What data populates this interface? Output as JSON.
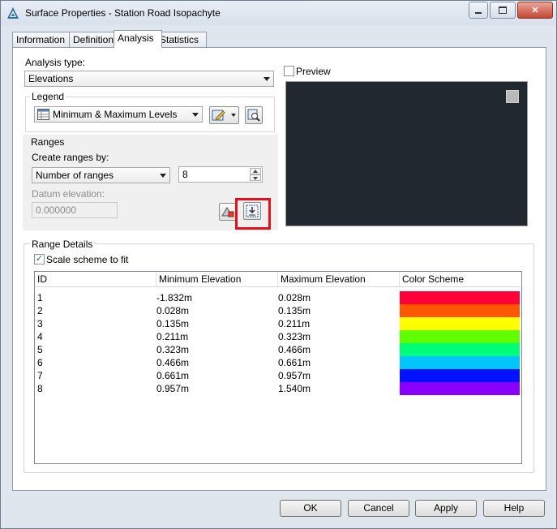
{
  "window": {
    "title": "Surface Properties - Station Road Isopachyte"
  },
  "tabs": [
    {
      "label": "Information"
    },
    {
      "label": "Definition"
    },
    {
      "label": "Analysis"
    },
    {
      "label": "Statistics"
    }
  ],
  "analysis": {
    "type_label": "Analysis type:",
    "type_value": "Elevations",
    "legend_label": "Legend",
    "legend_value": "Minimum & Maximum Levels",
    "ranges_label": "Ranges",
    "create_ranges_label": "Create ranges by:",
    "create_ranges_value": "Number of ranges",
    "number_of_ranges": "8",
    "datum_label": "Datum elevation:",
    "datum_value": "0.000000"
  },
  "preview": {
    "label": "Preview",
    "checked": false
  },
  "range_details": {
    "label": "Range Details",
    "scale_label": "Scale scheme to fit",
    "scale_checked": true,
    "headers": [
      "ID",
      "Minimum Elevation",
      "Maximum Elevation",
      "Color Scheme"
    ],
    "rows": [
      {
        "id": "1",
        "min": "-1.832m",
        "max": "0.028m",
        "color": "#ff0038"
      },
      {
        "id": "2",
        "min": "0.028m",
        "max": "0.135m",
        "color": "#ff5600"
      },
      {
        "id": "3",
        "min": "0.135m",
        "max": "0.211m",
        "color": "#ffff00"
      },
      {
        "id": "4",
        "min": "0.211m",
        "max": "0.323m",
        "color": "#60ff00"
      },
      {
        "id": "5",
        "min": "0.323m",
        "max": "0.466m",
        "color": "#00ff78"
      },
      {
        "id": "6",
        "min": "0.466m",
        "max": "0.661m",
        "color": "#00c6ff"
      },
      {
        "id": "7",
        "min": "0.661m",
        "max": "0.957m",
        "color": "#0012ff"
      },
      {
        "id": "8",
        "min": "0.957m",
        "max": "1.540m",
        "color": "#8a00ff"
      }
    ]
  },
  "buttons": {
    "ok": "OK",
    "cancel": "Cancel",
    "apply": "Apply",
    "help": "Help"
  },
  "icons": {
    "app": "autocad-civil-logo-icon",
    "legend_table": "table-icon",
    "style_edit": "edit-style-icon",
    "details": "magnify-details-icon",
    "run_analysis": "run-analysis-icon",
    "import": "import-ranges-icon"
  },
  "colors": {
    "accent": "#1f4f8f",
    "highlight": "#e8101b"
  }
}
